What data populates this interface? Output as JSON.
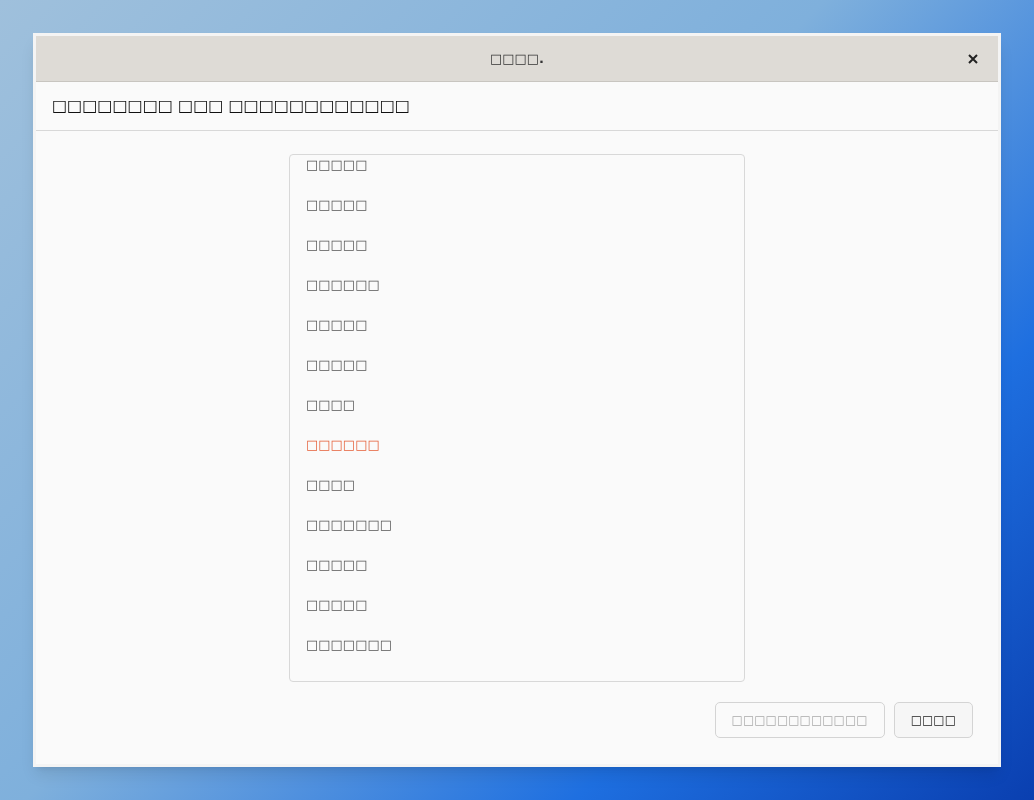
{
  "window": {
    "title": "□□□□."
  },
  "header": {
    "title": "□□□□□□□□ □□□ □□□□□□□□□□□□"
  },
  "list": {
    "items": [
      {
        "label": "□□□□□",
        "selected": false
      },
      {
        "label": "□□□□□",
        "selected": false
      },
      {
        "label": "□□□□□",
        "selected": false
      },
      {
        "label": "□□□□□□",
        "selected": false
      },
      {
        "label": "□□□□□",
        "selected": false
      },
      {
        "label": "□□□□□",
        "selected": false
      },
      {
        "label": "□□□□",
        "selected": false
      },
      {
        "label": "□□□□□□",
        "selected": true
      },
      {
        "label": "□□□□",
        "selected": false
      },
      {
        "label": "□□□□□□□",
        "selected": false
      },
      {
        "label": "□□□□□",
        "selected": false
      },
      {
        "label": "□□□□□",
        "selected": false
      },
      {
        "label": "□□□□□□□",
        "selected": false
      }
    ]
  },
  "buttons": [
    {
      "label": "□□□□□□□□□□□□",
      "disabled": true
    },
    {
      "label": "□□□□",
      "disabled": false
    }
  ]
}
